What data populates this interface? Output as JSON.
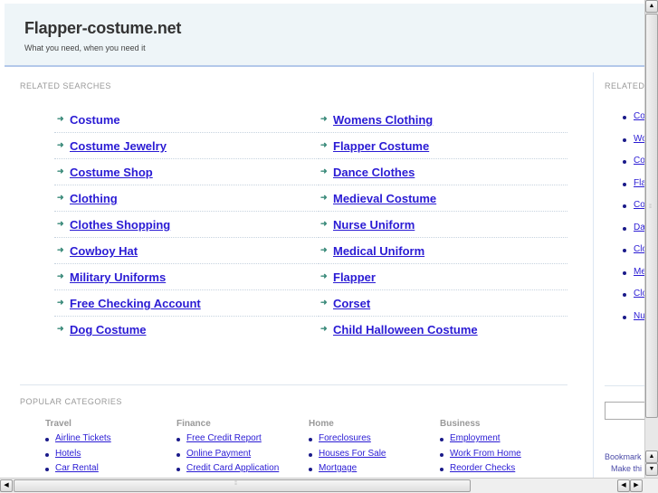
{
  "header": {
    "title": "Flapper-costume.net",
    "tagline": "What you need, when you need it"
  },
  "colors": {
    "header_bg": "#eef5f8",
    "header_border": "#b3c8ea",
    "link": "#2a1bd4",
    "arrow": "#3a8a7a",
    "label": "#999999"
  },
  "related": {
    "label": "RELATED SEARCHES",
    "arrow_icon": "➜",
    "left": [
      "Costume",
      "Costume Jewelry",
      "Costume Shop",
      "Clothing",
      "Clothes Shopping",
      "Cowboy Hat",
      "Military Uniforms",
      "Free Checking Account",
      "Dog Costume"
    ],
    "right": [
      "Womens Clothing",
      "Flapper Costume",
      "Dance Clothes",
      "Medieval Costume",
      "Nurse Uniform",
      "Medical Uniform",
      "Flapper",
      "Corset",
      "Child Halloween Costume"
    ]
  },
  "sidebar": {
    "label": "RELATED",
    "items": [
      "Co",
      "Wo",
      "Co",
      "Fla",
      "Co",
      "Da",
      "Clo",
      "Me",
      "Clo",
      "Nu"
    ],
    "search_value": "",
    "bookmark": "Bookmark",
    "make_this": "Make thi"
  },
  "popular": {
    "label": "POPULAR CATEGORIES",
    "categories": [
      {
        "title": "Travel",
        "items": [
          "Airline Tickets",
          "Hotels",
          "Car Rental"
        ]
      },
      {
        "title": "Finance",
        "items": [
          "Free Credit Report",
          "Online Payment",
          "Credit Card Application"
        ]
      },
      {
        "title": "Home",
        "items": [
          "Foreclosures",
          "Houses For Sale",
          "Mortgage"
        ]
      },
      {
        "title": "Business",
        "items": [
          "Employment",
          "Work From Home",
          "Reorder Checks"
        ]
      }
    ]
  },
  "scrollbars": {
    "up_icon": "▲",
    "down_icon": "▼",
    "left_icon": "◀",
    "right_icon": "▶",
    "grip": "⁞⁞⁞"
  }
}
